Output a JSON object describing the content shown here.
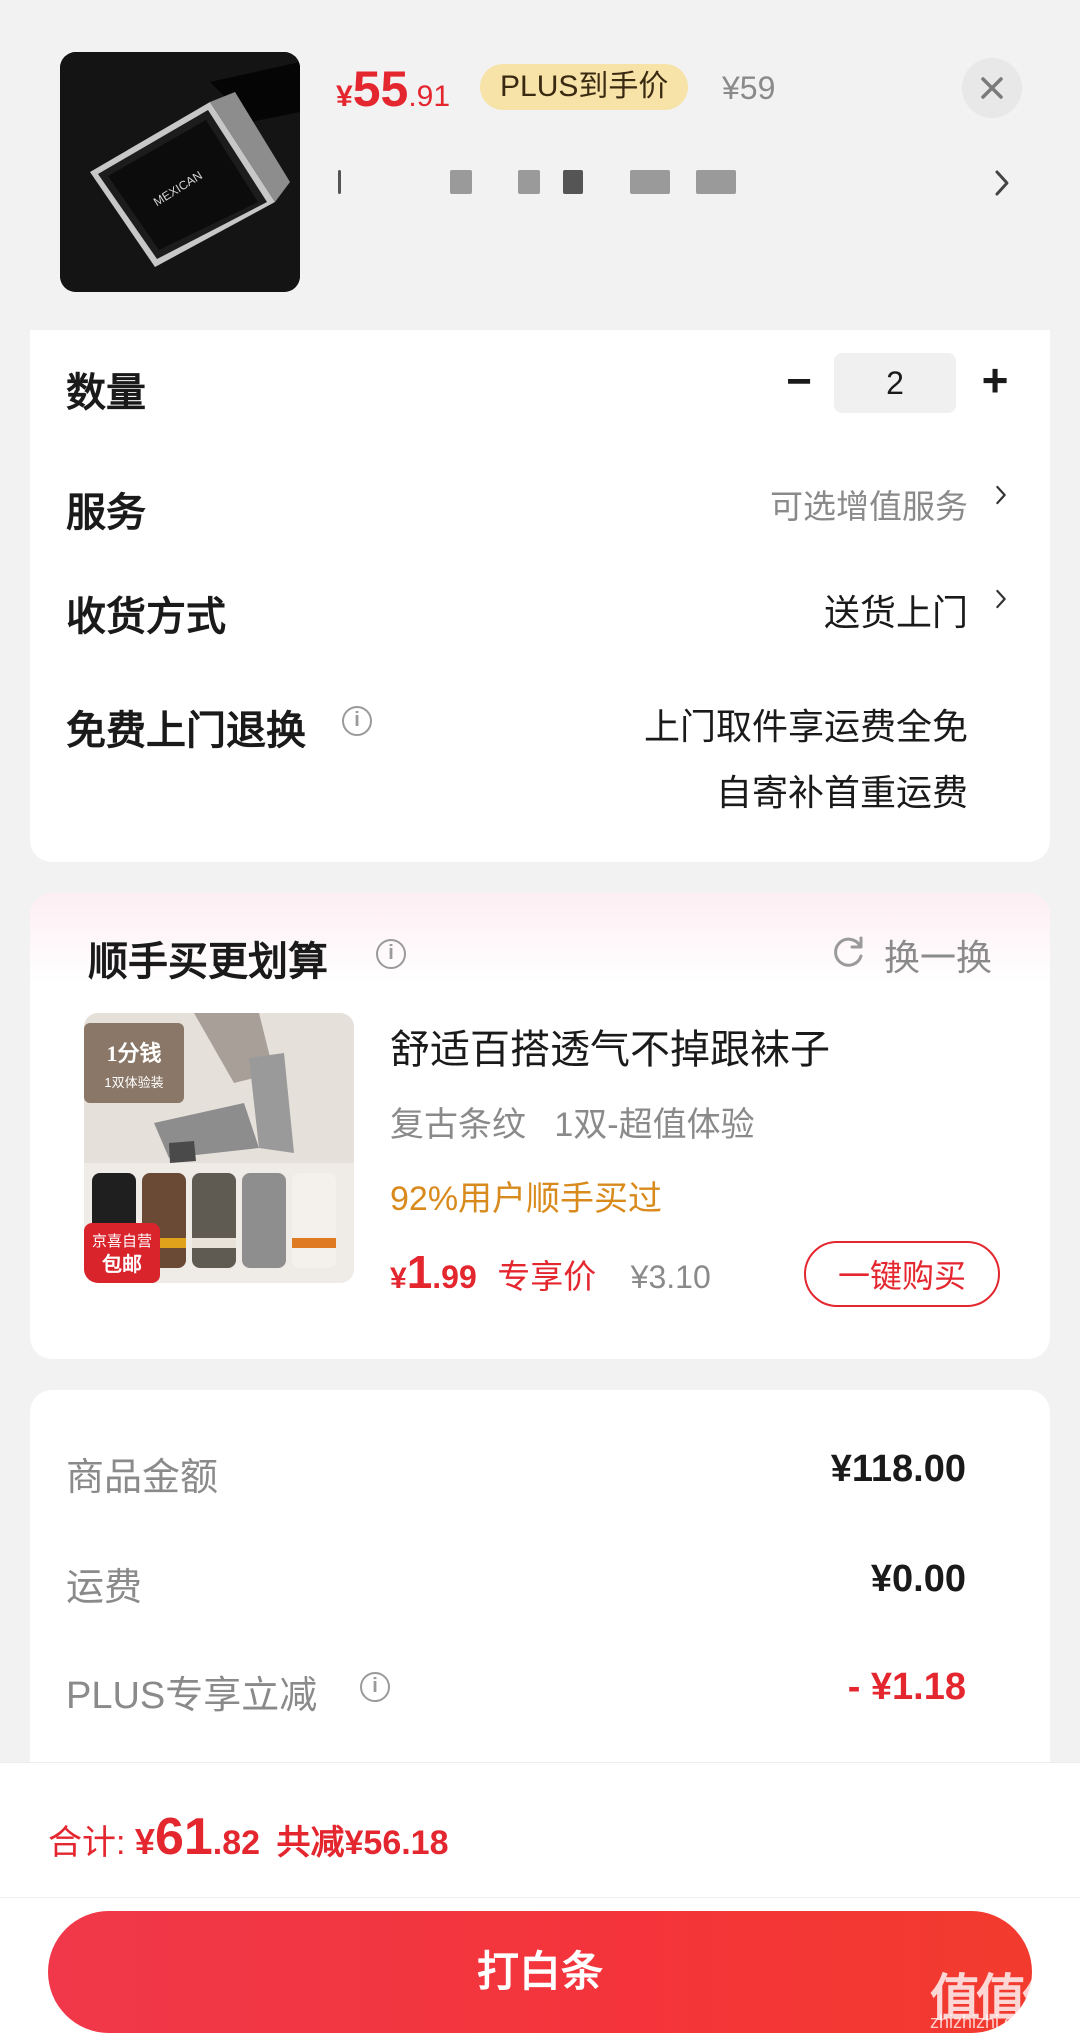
{
  "product": {
    "price_symbol": "¥",
    "price_int": "55",
    "price_dec": ".91",
    "plus_badge": "PLUS到手价",
    "original_price": "¥59",
    "thumb_brand": "MEXICAN"
  },
  "options": {
    "quantity_label": "数量",
    "quantity_minus": "−",
    "quantity_value": "2",
    "quantity_plus": "+",
    "service_label": "服务",
    "service_value": "可选增值服务",
    "delivery_label": "收货方式",
    "delivery_value": "送货上门",
    "return_label": "免费上门退换",
    "return_line1": "上门取件享运费全免",
    "return_line2": "自寄补首重运费"
  },
  "addon": {
    "title": "顺手买更划算",
    "refresh_label": "换一换",
    "img_tag1": "1分钱",
    "img_tag2": "1双体验装",
    "img_badge1": "京喜自营",
    "img_badge2": "包邮",
    "name": "舒适百搭透气不掉跟袜子",
    "spec": "复古条纹   1双-超值体验",
    "social_proof": "92%用户顺手买过",
    "price_symbol": "¥",
    "price_int": "1",
    "price_dec": ".99",
    "price_tag": "专享价",
    "original_price": "¥3.10",
    "buy_label": "一键购买"
  },
  "summary": {
    "goods_label": "商品金额",
    "goods_value": "¥118.00",
    "shipping_label": "运费",
    "shipping_value": "¥0.00",
    "plus_label": "PLUS专享立减",
    "plus_value": "- ¥1.18"
  },
  "footer": {
    "total_label": "合计: ",
    "total_symbol": "¥",
    "total_int": "61",
    "total_dec": ".82",
    "saved": "共减¥56.18",
    "pay_button": "打白条"
  },
  "watermark": {
    "main": "值值值",
    "sub": "zhizhizhi.com"
  },
  "colors": {
    "accent_red": "#e4262f",
    "plus_gold": "#f7e2a8",
    "proof_orange": "#d98a1c"
  }
}
